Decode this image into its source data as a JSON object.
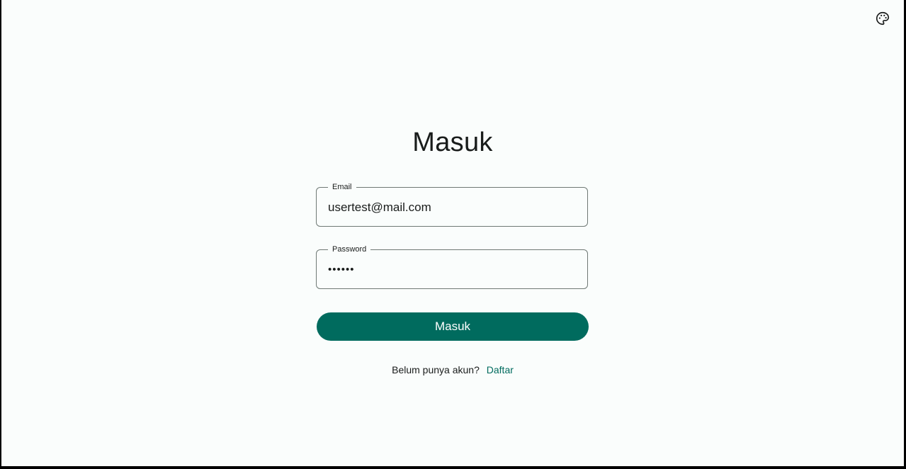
{
  "header": {
    "theme_icon": "palette-icon"
  },
  "login": {
    "title": "Masuk",
    "email": {
      "label": "Email",
      "value": "usertest@mail.com"
    },
    "password": {
      "label": "Password",
      "value": "••••••"
    },
    "submit_label": "Masuk",
    "register_prompt": "Belum punya akun?",
    "register_link": "Daftar"
  },
  "colors": {
    "primary": "#006b5e",
    "background": "#fafdfc",
    "text": "#191c1b",
    "outline": "#6f7975"
  }
}
